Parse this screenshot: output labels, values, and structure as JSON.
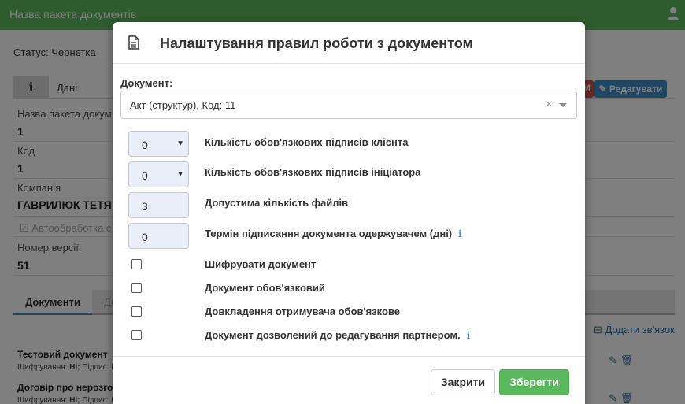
{
  "app": {
    "title": "Назва пакета документів",
    "user_icon": "user-icon"
  },
  "page": {
    "status": "Статус: Чернетка",
    "info_tab_icon": "i",
    "info_tab_label": "Дані",
    "red_button_label": "М",
    "edit_button_label": "✎ Редагувати",
    "fields": [
      {
        "label": "Назва пакета докум",
        "value": "1"
      },
      {
        "label": "Код",
        "value": "1"
      },
      {
        "label": "Компанія",
        "value": "ГАВРИЛЮК ТЕТЯ"
      },
      {
        "label": "Номер версії:",
        "value": "51"
      }
    ],
    "auto_checkbox_label": "Автообработка с",
    "doc_tabs": [
      "Документи",
      "До"
    ],
    "add_link_label": "Додати зв'язок",
    "documents": [
      {
        "title": "Тестовий документ",
        "meta_prefix": "Шифрування:",
        "meta_value": "Ні;",
        "meta_suffix": "Підпис: К"
      },
      {
        "title": "Договір про нерозго",
        "meta_prefix": "Шифрування:",
        "meta_value": "Ні;",
        "meta_suffix": "Підпис: К"
      }
    ]
  },
  "modal": {
    "title": "Налаштування правил роботи з документом",
    "header_icon": "document-icon",
    "document_label": "Документ:",
    "document_value": "Акт (структур), Код: 11",
    "clear_symbol": "×",
    "numeric_options": [
      {
        "value": "0",
        "has_caret": true,
        "label": "Кількість обов'язкових підписів клієнта",
        "info": false
      },
      {
        "value": "0",
        "has_caret": true,
        "label": "Кількість обов'язкових підписів ініціатора",
        "info": false
      },
      {
        "value": "3",
        "has_caret": false,
        "label": "Допустима кількість файлів",
        "info": false
      },
      {
        "value": "0",
        "has_caret": false,
        "label": "Термін підписання документа одержувачем (дні)",
        "info": true
      }
    ],
    "checkbox_options": [
      {
        "label": "Шифрувати документ",
        "checked": false,
        "info": false
      },
      {
        "label": "Документ обов'язковий",
        "checked": false,
        "info": false
      },
      {
        "label": "Довкладення отримувача обов'язкове",
        "checked": false,
        "info": false
      },
      {
        "label": "Документ дозволений до редагування партнером.",
        "checked": false,
        "info": true
      }
    ],
    "close_label": "Закрити",
    "save_label": "Зберегти"
  },
  "colors": {
    "topbar": "#5cb85c",
    "primary": "#3e8fc8",
    "save": "#5cb85c",
    "danger": "#d9534f"
  }
}
